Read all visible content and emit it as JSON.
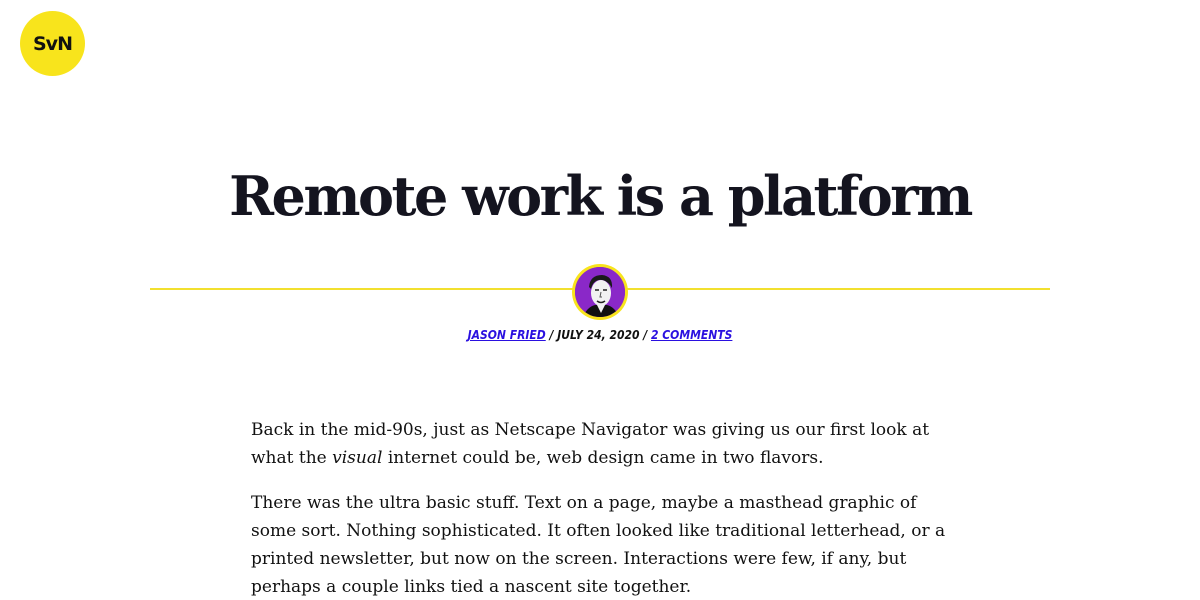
{
  "logo": {
    "text": "SvN",
    "color": "#f8e41c"
  },
  "post": {
    "title": "Remote work is a platform",
    "author": "JASON FRIED",
    "separator1": " / ",
    "date": "JULY 24, 2020",
    "separator2": " / ",
    "comments": "2 COMMENTS"
  },
  "body": {
    "p1_before": "Back in the mid-90s, just as Netscape Navigator was giving us our first look at what the ",
    "p1_em": "visual",
    "p1_after": " internet could be, web design came in two flavors.",
    "p2": "There was the ultra basic stuff. Text on a page, maybe a masthead graphic of some sort. Nothing sophisticated. It often looked like traditional letterhead, or a printed newsletter, but now on the screen. Interactions were few, if any, but perhaps a couple links tied a nascent site together."
  },
  "colors": {
    "accent_yellow": "#f8e41c",
    "link_blue": "#2a10e0",
    "avatar_purple": "#8a28c8"
  },
  "icons": {
    "avatar": "author-avatar-photo"
  }
}
